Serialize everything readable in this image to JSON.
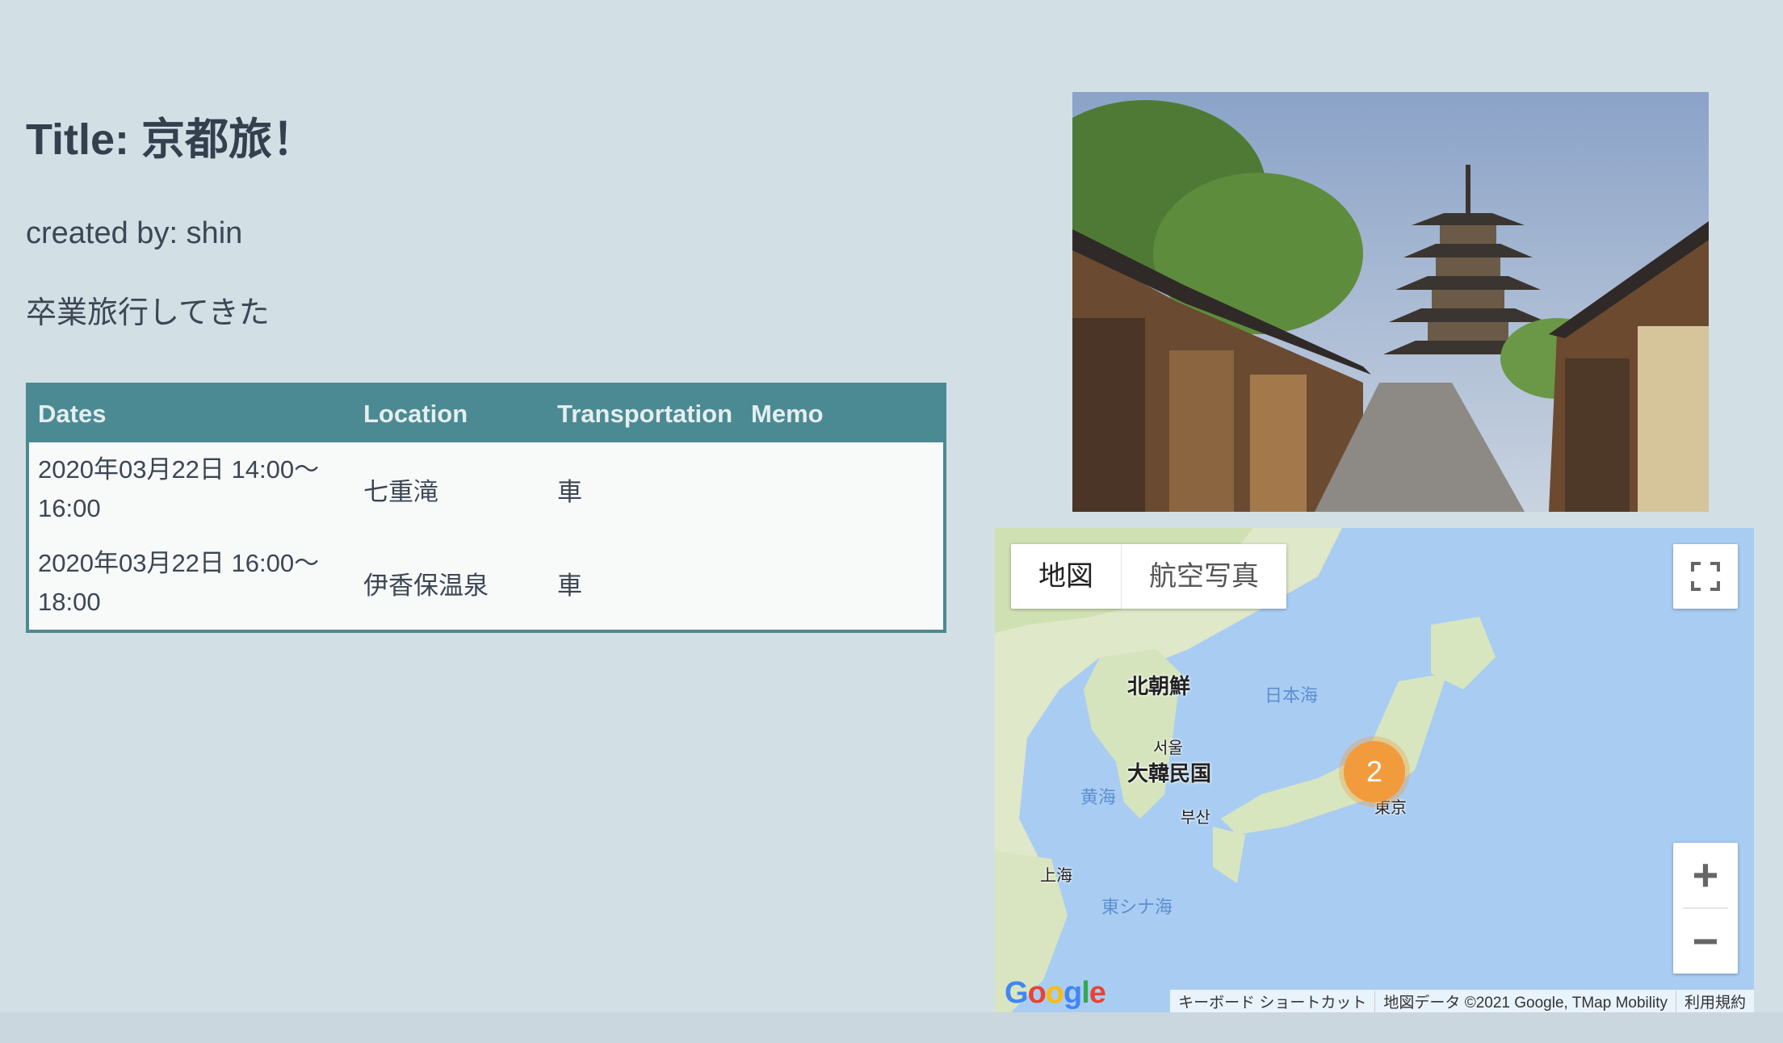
{
  "trip": {
    "title": "Title: 京都旅！",
    "created_by": "created by: shin",
    "description": "卒業旅行してきた"
  },
  "table": {
    "headers": [
      "Dates",
      "Location",
      "Transportation",
      "Memo"
    ],
    "rows": [
      {
        "dates": "2020年03月22日 14:00〜\n16:00",
        "location": "七重滝",
        "transportation": "車",
        "memo": ""
      },
      {
        "dates": "2020年03月22日 16:00〜\n18:00",
        "location": "伊香保温泉",
        "transportation": "車",
        "memo": ""
      }
    ]
  },
  "map": {
    "type_map": "地図",
    "type_satellite": "航空写真",
    "zoom_in": "+",
    "zoom_out": "−",
    "cluster_count": "2",
    "labels": {
      "north_korea": "北朝鮮",
      "south_korea": "大韓民国",
      "seoul": "서울",
      "busan": "부산",
      "tokyo": "東京",
      "shanghai": "上海",
      "sea_of_japan": "日本海",
      "yellow_sea": "黄海",
      "east_china_sea": "東シナ海"
    },
    "footer": {
      "shortcuts": "キーボード ショートカット",
      "attribution": "地図データ ©2021 Google, TMap Mobility",
      "terms": "利用規約"
    },
    "logo": "Google"
  },
  "icons": {
    "fullscreen": "fullscreen-icon",
    "photo": "kyoto-pagoda-photo"
  }
}
